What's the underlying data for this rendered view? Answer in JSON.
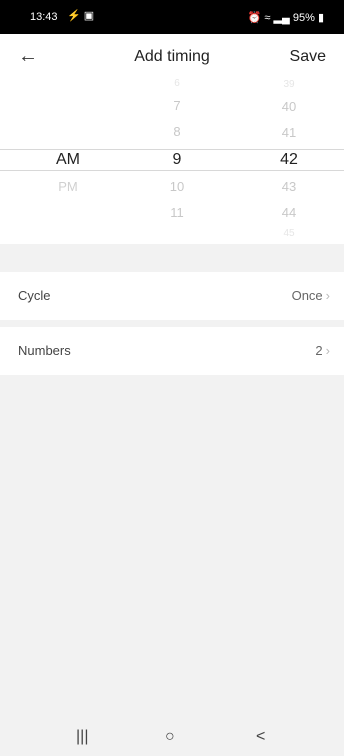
{
  "status_bar": {
    "time": "13:43",
    "right": "95%"
  },
  "header": {
    "back_icon": "arrow-left-icon",
    "title": "Add timing",
    "save_label": "Save"
  },
  "picker": {
    "ampm": [
      {
        "text": "AM",
        "state": "selected"
      },
      {
        "text": "PM",
        "state": "faded"
      }
    ],
    "hours": [
      {
        "text": "6",
        "state": "far"
      },
      {
        "text": "7",
        "state": "near"
      },
      {
        "text": "8",
        "state": "near"
      },
      {
        "text": "9",
        "state": "selected"
      },
      {
        "text": "10",
        "state": "near"
      },
      {
        "text": "11",
        "state": "near"
      }
    ],
    "minutes": [
      {
        "text": "39",
        "state": "far"
      },
      {
        "text": "40",
        "state": "near"
      },
      {
        "text": "41",
        "state": "near"
      },
      {
        "text": "42",
        "state": "selected"
      },
      {
        "text": "43",
        "state": "near"
      },
      {
        "text": "44",
        "state": "near"
      },
      {
        "text": "45",
        "state": "far"
      }
    ]
  },
  "rows": [
    {
      "label": "Cycle",
      "value": "Once"
    },
    {
      "label": "Numbers",
      "value": "2"
    }
  ],
  "nav": {
    "recent_icon": "recent-apps-icon",
    "home_icon": "home-icon",
    "back_icon": "back-nav-icon"
  }
}
